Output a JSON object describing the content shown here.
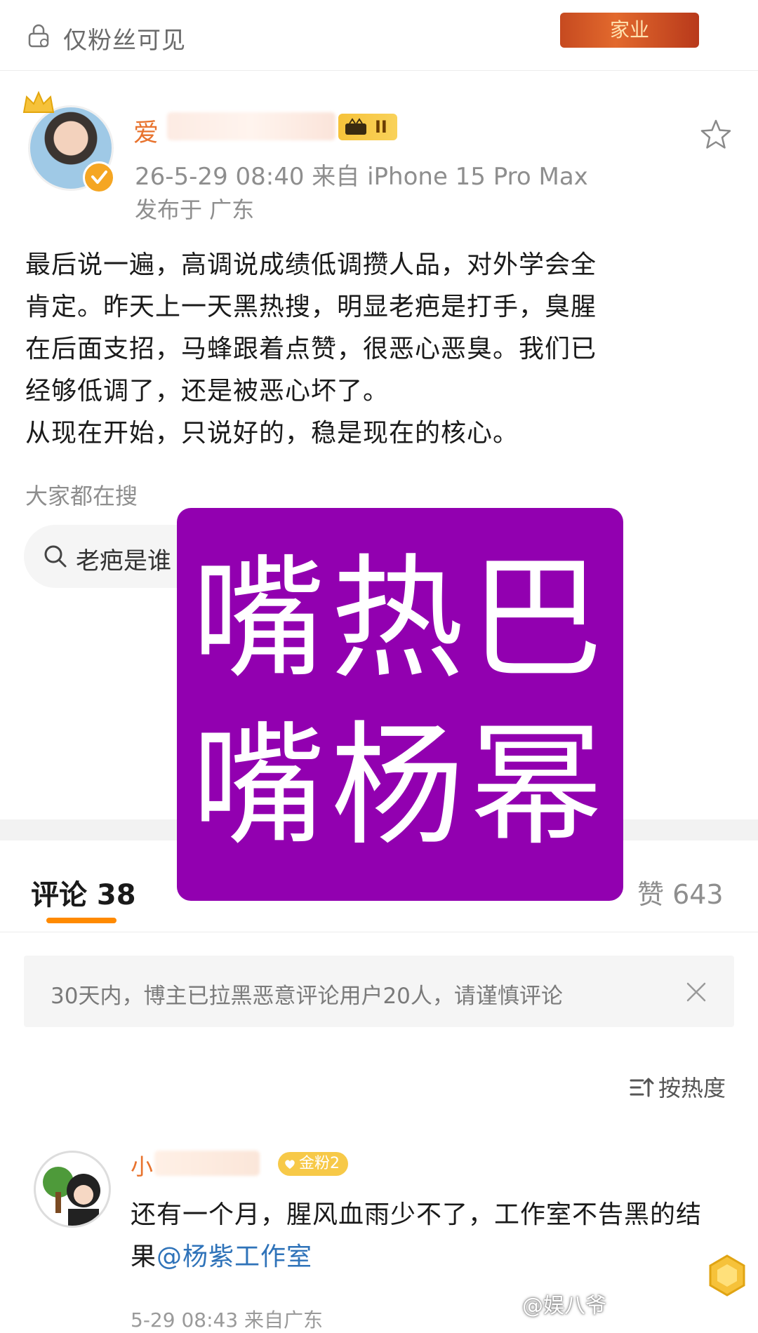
{
  "header": {
    "visibility": "仅粉丝可见",
    "banner_text": "家业"
  },
  "post": {
    "author_visible": "爱",
    "level_badge": "II",
    "meta": "26-5-29 08:40   来自 iPhone 15 Pro Max",
    "location": "发布于 广东",
    "body": "最后说一遍，高调说成绩低调攒人品，对外学会全\n肯定。昨天上一天黑热搜，明显老疤是打手，臭腥\n在后面支招，马蜂跟着点赞，很恶心恶臭。我们已\n经够低调了，还是被恶心坏了。\n从现在开始，只说好的，稳是现在的核心。",
    "trending_label": "大家都在搜",
    "trending_chip": "老疤是谁"
  },
  "overlay": {
    "line1": "嘴热巴",
    "line2": "嘴杨幂",
    "color": "#9200b0"
  },
  "tabs": {
    "comments": "评论 38",
    "likes": "赞 643"
  },
  "notice": {
    "text": "30天内，博主已拉黑恶意评论用户20人，请谨慎评论"
  },
  "sort": {
    "label": "按热度"
  },
  "comment": {
    "user_visible": "小",
    "fan_badge": "金粉2",
    "body_text": "还有一个月，腥风血雨少不了，工作室不告黑的结果",
    "mention": "@杨紫工作室",
    "meta": "5-29 08:43  来自广东"
  },
  "watermark": "@娱八爷",
  "colors": {
    "accent_orange": "#ff8a00",
    "username_orange": "#e8732e",
    "mention_blue": "#2f73b9"
  }
}
